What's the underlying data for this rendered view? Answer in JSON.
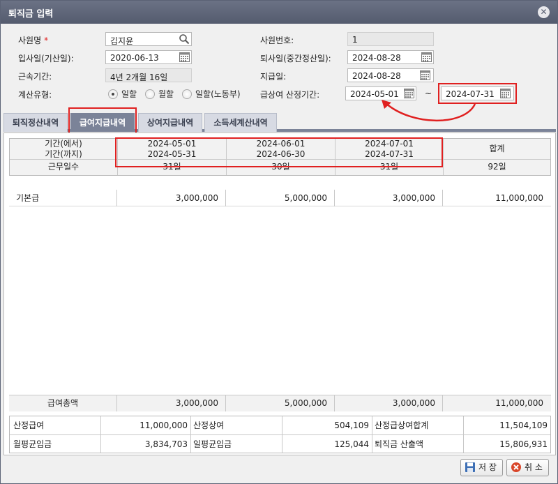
{
  "window": {
    "title": "퇴직금 입력"
  },
  "form": {
    "employee_name_label": "사원명",
    "required_mark": "*",
    "employee_name": "김지윤",
    "employee_no_label": "사원번호:",
    "employee_no": "1",
    "hire_date_label": "입사일(기산일):",
    "hire_date": "2020-06-13",
    "retire_date_label": "퇴사일(중간정산일):",
    "retire_date": "2024-08-28",
    "tenure_label": "근속기간:",
    "tenure": "4년 2개월 16일",
    "pay_date_label": "지급일:",
    "pay_date": "2024-08-28",
    "calc_type_label": "계산유형:",
    "calc_options": [
      "일할",
      "월할",
      "일할(노동부)"
    ],
    "calc_selected_index": 0,
    "bonus_period_label": "급상여 산정기간:",
    "bonus_period_from": "2024-05-01",
    "bonus_period_sep": "~",
    "bonus_period_to": "2024-07-31"
  },
  "tabs": [
    {
      "label": "퇴직정산내역",
      "active": false
    },
    {
      "label": "급여지급내역",
      "active": true
    },
    {
      "label": "상여지급내역",
      "active": false
    },
    {
      "label": "소득세계산내역",
      "active": false
    }
  ],
  "grid": {
    "period_from_label": "기간(에서)",
    "period_to_label": "기간(까지)",
    "days_label": "근무일수",
    "total_label": "합계",
    "periods": [
      {
        "from": "2024-05-01",
        "to": "2024-05-31",
        "days": "31일"
      },
      {
        "from": "2024-06-01",
        "to": "2024-06-30",
        "days": "30일"
      },
      {
        "from": "2024-07-01",
        "to": "2024-07-31",
        "days": "31일"
      }
    ],
    "total_days": "92일",
    "rows": [
      {
        "name": "기본급",
        "values": [
          "3,000,000",
          "5,000,000",
          "3,000,000"
        ],
        "total": "11,000,000"
      }
    ],
    "footer": {
      "name": "급여총액",
      "values": [
        "3,000,000",
        "5,000,000",
        "3,000,000"
      ],
      "total": "11,000,000"
    }
  },
  "summary": {
    "base_salary_label": "산정급여",
    "base_salary": "11,000,000",
    "base_bonus_label": "산정상여",
    "base_bonus": "504,109",
    "base_total_label": "산정급상여합계",
    "base_total": "11,504,109",
    "monthly_avg_label": "월평균임금",
    "monthly_avg": "3,834,703",
    "daily_avg_label": "일평균임금",
    "daily_avg": "125,044",
    "severance_label": "퇴직금 산출액",
    "severance": "15,806,931"
  },
  "buttons": {
    "save": "저 장",
    "cancel": "취 소"
  },
  "colors": {
    "highlight": "#e02020",
    "titlebar": "#5b6275",
    "active_tab": "#7b8398"
  },
  "icons": {
    "search": "search-icon",
    "calendar": "calendar-icon",
    "close": "close-icon",
    "save": "floppy-icon",
    "cancel": "cancel-icon"
  }
}
